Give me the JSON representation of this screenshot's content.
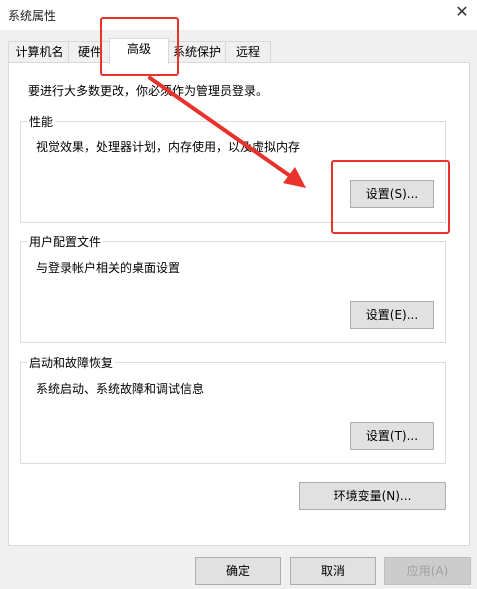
{
  "window": {
    "title": "系统属性",
    "close_glyph": "✕"
  },
  "tabs": [
    {
      "label": "计算机名"
    },
    {
      "label": "硬件"
    },
    {
      "label": "高级"
    },
    {
      "label": "系统保护"
    },
    {
      "label": "远程"
    }
  ],
  "advanced": {
    "admin_note": "要进行大多数更改，你必须作为管理员登录。",
    "performance": {
      "legend": "性能",
      "description": "视觉效果，处理器计划，内存使用，以及虚拟内存",
      "button": "设置(S)..."
    },
    "user_profiles": {
      "legend": "用户配置文件",
      "description": "与登录帐户相关的桌面设置",
      "button": "设置(E)..."
    },
    "startup_recovery": {
      "legend": "启动和故障恢复",
      "description": "系统启动、系统故障和调试信息",
      "button": "设置(T)..."
    },
    "env_button": "环境变量(N)..."
  },
  "footer": {
    "ok": "确定",
    "cancel": "取消",
    "apply": "应用(A)"
  },
  "annotation": {
    "color": "#e8322b"
  }
}
